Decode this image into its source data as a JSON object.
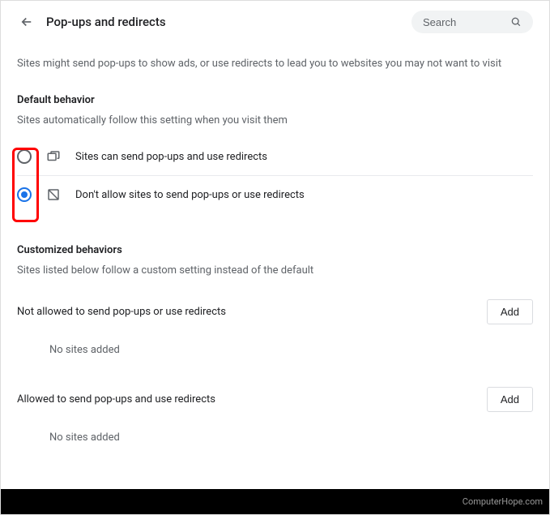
{
  "header": {
    "title": "Pop-ups and redirects",
    "search_placeholder": "Search"
  },
  "intro": "Sites might send pop-ups to show ads, or use redirects to lead you to websites you may not want to visit",
  "default_behavior": {
    "title": "Default behavior",
    "subtitle": "Sites automatically follow this setting when you visit them",
    "options": [
      {
        "label": "Sites can send pop-ups and use redirects",
        "checked": false
      },
      {
        "label": "Don't allow sites to send pop-ups or use redirects",
        "checked": true
      }
    ]
  },
  "customized": {
    "title": "Customized behaviors",
    "subtitle": "Sites listed below follow a custom setting instead of the default",
    "block": {
      "title": "Not allowed to send pop-ups or use redirects",
      "add_label": "Add",
      "empty": "No sites added"
    },
    "allow": {
      "title": "Allowed to send pop-ups and use redirects",
      "add_label": "Add",
      "empty": "No sites added"
    }
  },
  "footer": "ComputerHope.com"
}
